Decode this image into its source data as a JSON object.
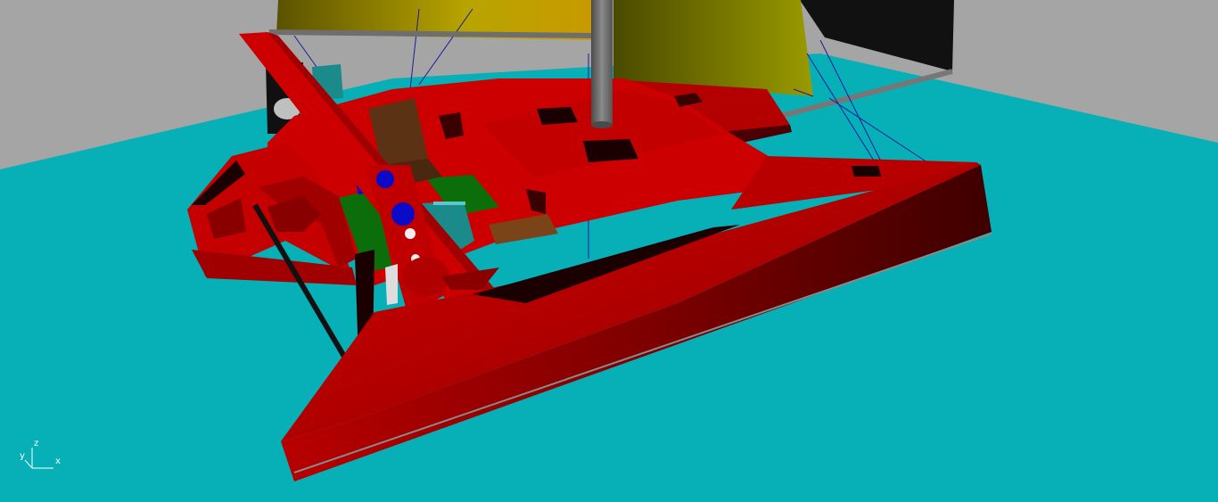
{
  "viewport": {
    "background_color": "#a5a5a5",
    "ground_color": "#06b0b6",
    "hull_color": "#cc0000",
    "hull_shadow_color": "#5a0000",
    "sail_main_color": "#a89a00",
    "sail_jib_color": "#8c8c00",
    "sail_dark_color": "#111111",
    "mast_color": "#6e6e6e",
    "rigging_color": "#1a1aa0",
    "seat_color": "#5c3214",
    "green_color": "#0b6e0b",
    "blue_color": "#0a0ac8",
    "cyan_part_color": "#1a8a8a"
  },
  "axis_tripod": {
    "z_label": "z",
    "y_label": "y",
    "x_label": "x"
  }
}
